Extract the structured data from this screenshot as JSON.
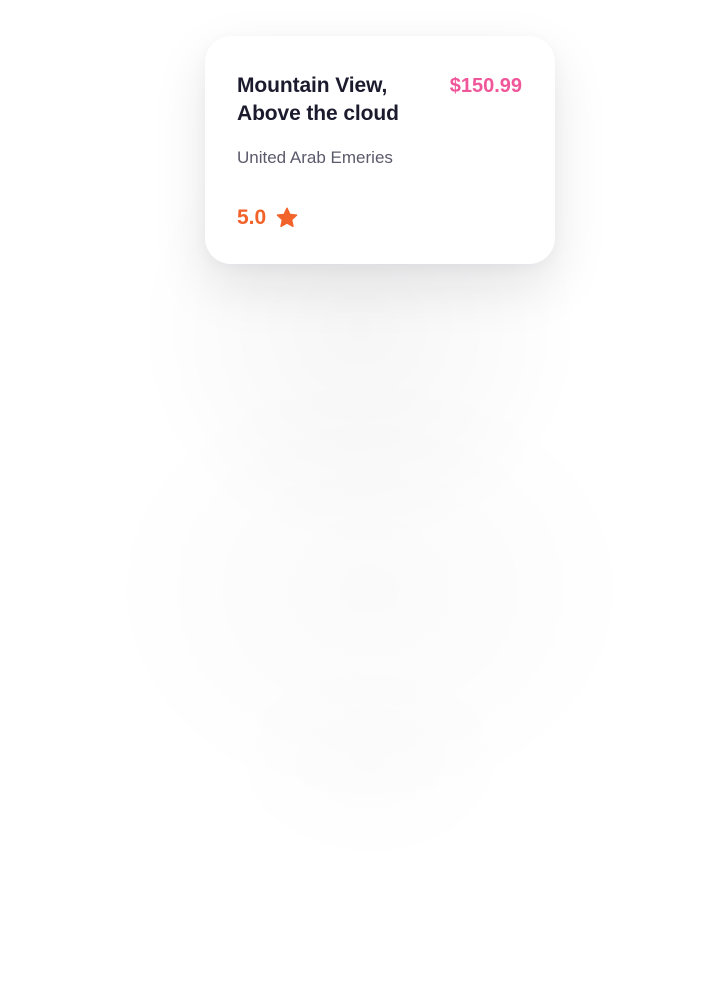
{
  "card": {
    "title_line1": "Mountain View,",
    "title_line2": "Above the cloud",
    "price": "$150.99",
    "location": "United Arab Emeries",
    "rating": "5.0",
    "rating_icon": "star-icon"
  },
  "colors": {
    "price": "#f0569a",
    "rating": "#f2622b",
    "title": "#1c1b2e",
    "location": "#5b5a6b"
  }
}
